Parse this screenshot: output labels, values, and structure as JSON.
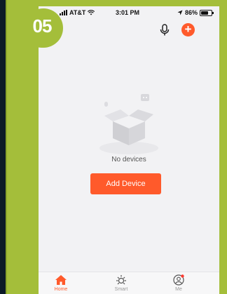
{
  "step_badge": {
    "number": "05",
    "color": "#a4be3a"
  },
  "status_bar": {
    "carrier": "AT&T",
    "time": "3:01 PM",
    "battery": "86%",
    "battery_level": 0.86
  },
  "header": {
    "mic_icon": "microphone-icon",
    "add_icon": "plus-icon"
  },
  "empty_state": {
    "message": "No devices",
    "button_label": "Add Device"
  },
  "tabs": [
    {
      "label": "Home",
      "icon": "home-icon",
      "active": true
    },
    {
      "label": "Smart",
      "icon": "sun-icon",
      "active": false
    },
    {
      "label": "Me",
      "icon": "user-icon",
      "active": false
    }
  ],
  "colors": {
    "accent": "#ff5a2b",
    "frame": "#a4be3a"
  }
}
